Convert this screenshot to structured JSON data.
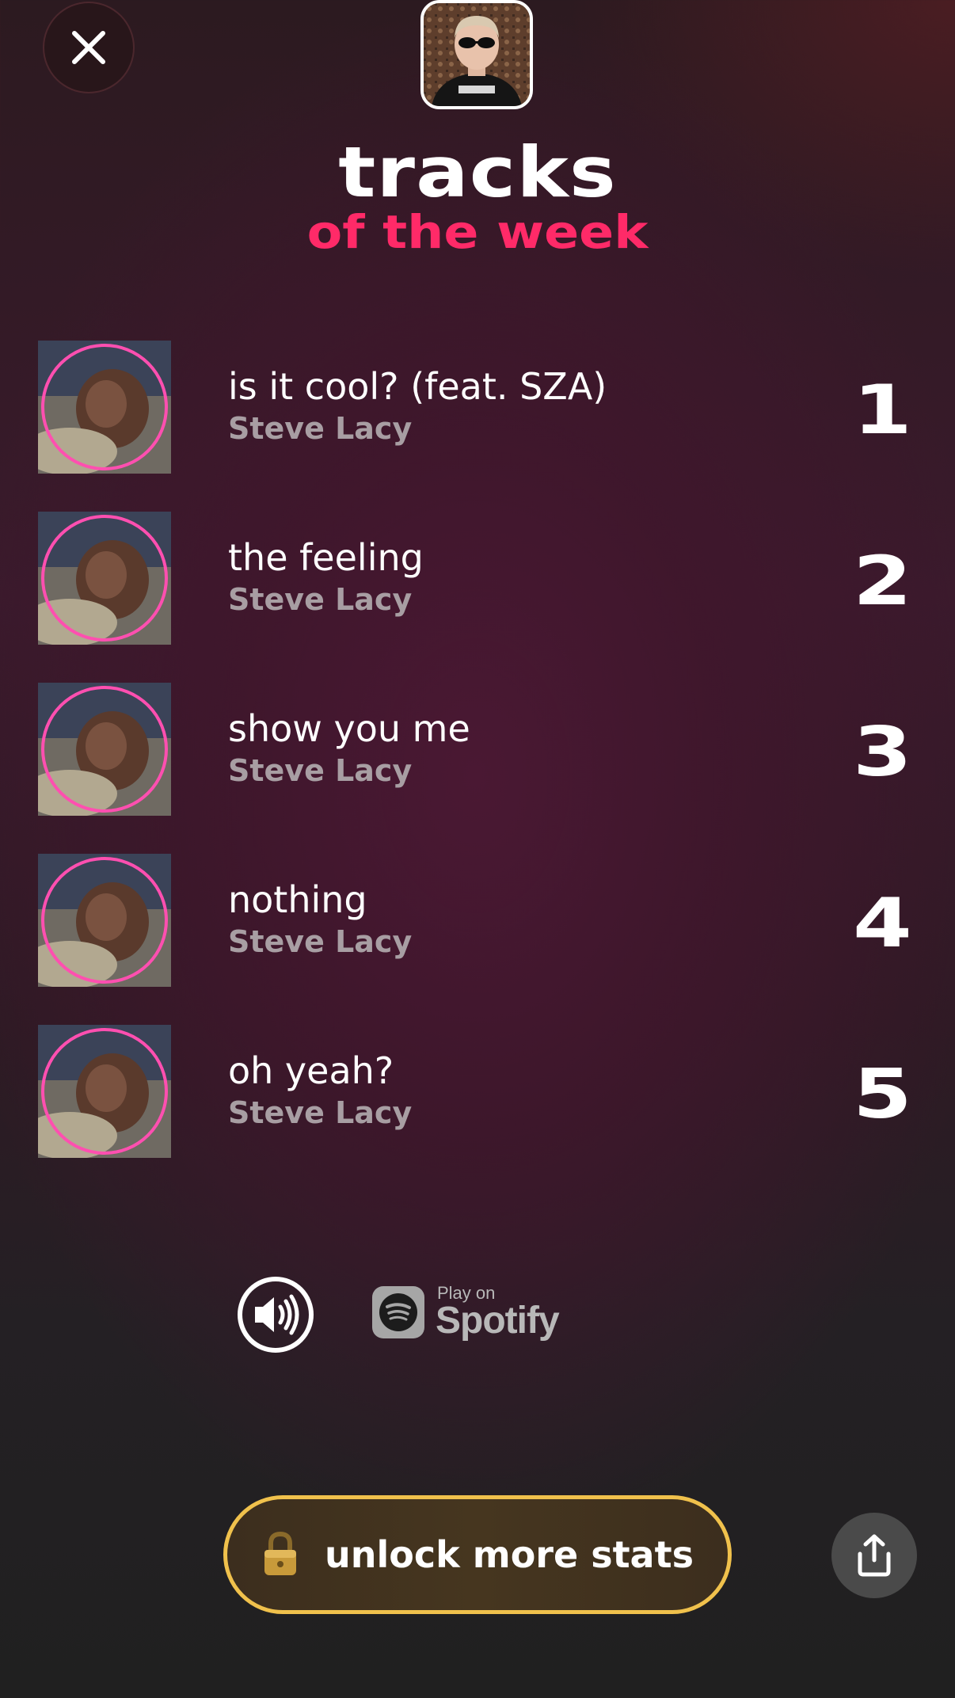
{
  "header": {
    "title": "tracks",
    "subtitle": "of the week"
  },
  "tracks": [
    {
      "rank": "1",
      "title": "is it cool? (feat. SZA)",
      "artist": "Steve Lacy"
    },
    {
      "rank": "2",
      "title": "the feeling",
      "artist": "Steve Lacy"
    },
    {
      "rank": "3",
      "title": "show you me",
      "artist": "Steve Lacy"
    },
    {
      "rank": "4",
      "title": "nothing",
      "artist": "Steve Lacy"
    },
    {
      "rank": "5",
      "title": "oh yeah?",
      "artist": "Steve Lacy"
    }
  ],
  "player": {
    "spotify_prefix": "Play on",
    "spotify_name": "Spotify"
  },
  "cta": {
    "unlock_label": "unlock more stats"
  },
  "icons": {
    "close": "close-icon",
    "sound": "volume-icon",
    "spotify": "spotify-logo-icon",
    "lock": "lock-icon",
    "share": "share-icon"
  },
  "colors": {
    "accent": "#ff2a68",
    "gold": "#f0c14c",
    "cover_ring": "#ff4fb0"
  }
}
